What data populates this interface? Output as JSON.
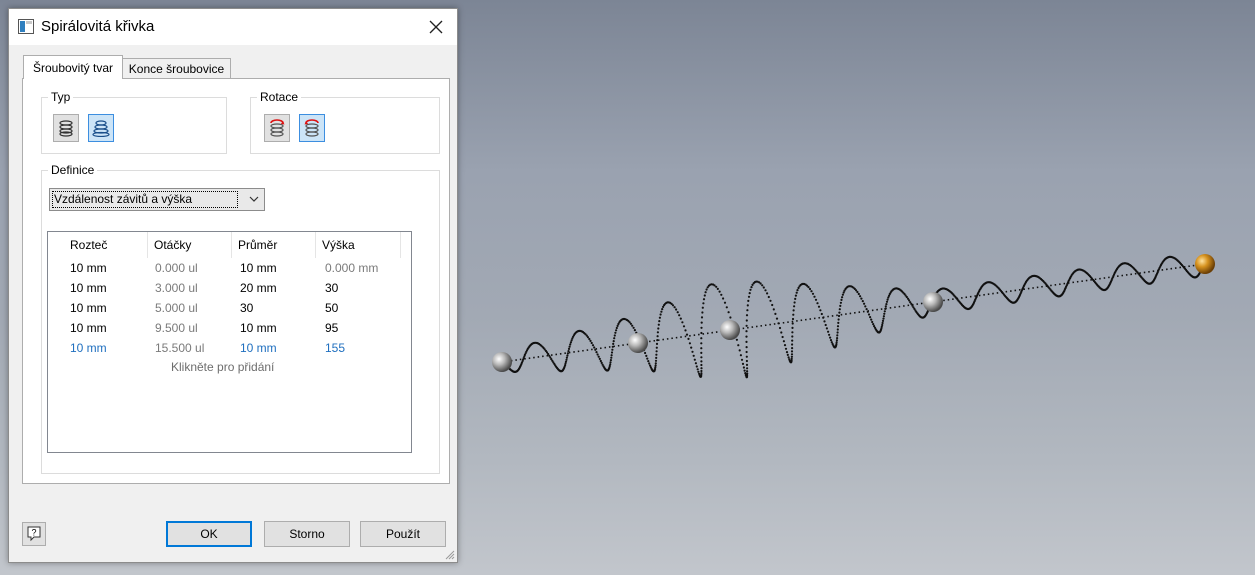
{
  "dialog": {
    "title": "Spirálovitá křivka",
    "tabs": [
      {
        "label": "Šroubovitý tvar",
        "active": true
      },
      {
        "label": "Konce šroubovice",
        "active": false
      }
    ],
    "groups": {
      "type_label": "Typ",
      "rotation_label": "Rotace",
      "definition_label": "Definice"
    },
    "definition_select": {
      "value": "Vzdálenost závitů a výška"
    },
    "table": {
      "columns": [
        "Rozteč",
        "Otáčky",
        "Průměr",
        "Výška"
      ],
      "rows": [
        [
          "10 mm",
          "0.000 ul",
          "10 mm",
          "0.000 mm"
        ],
        [
          "10 mm",
          "3.000 ul",
          "20 mm",
          "30"
        ],
        [
          "10 mm",
          "5.000 ul",
          "30",
          "50"
        ],
        [
          "10 mm",
          "9.500 ul",
          "10 mm",
          "95"
        ],
        [
          "10 mm",
          "15.500 ul",
          "10 mm",
          "155"
        ]
      ],
      "add_row_hint": "Klikněte pro přidání"
    },
    "buttons": {
      "help": "?",
      "ok": "OK",
      "cancel": "Storno",
      "apply": "Použít"
    }
  },
  "colors": {
    "selected_button_bg": "#cce4f7",
    "selected_button_border": "#3c8ee0",
    "link_blue": "#1f6fbf",
    "end_point_orange": "#c98a1f"
  }
}
